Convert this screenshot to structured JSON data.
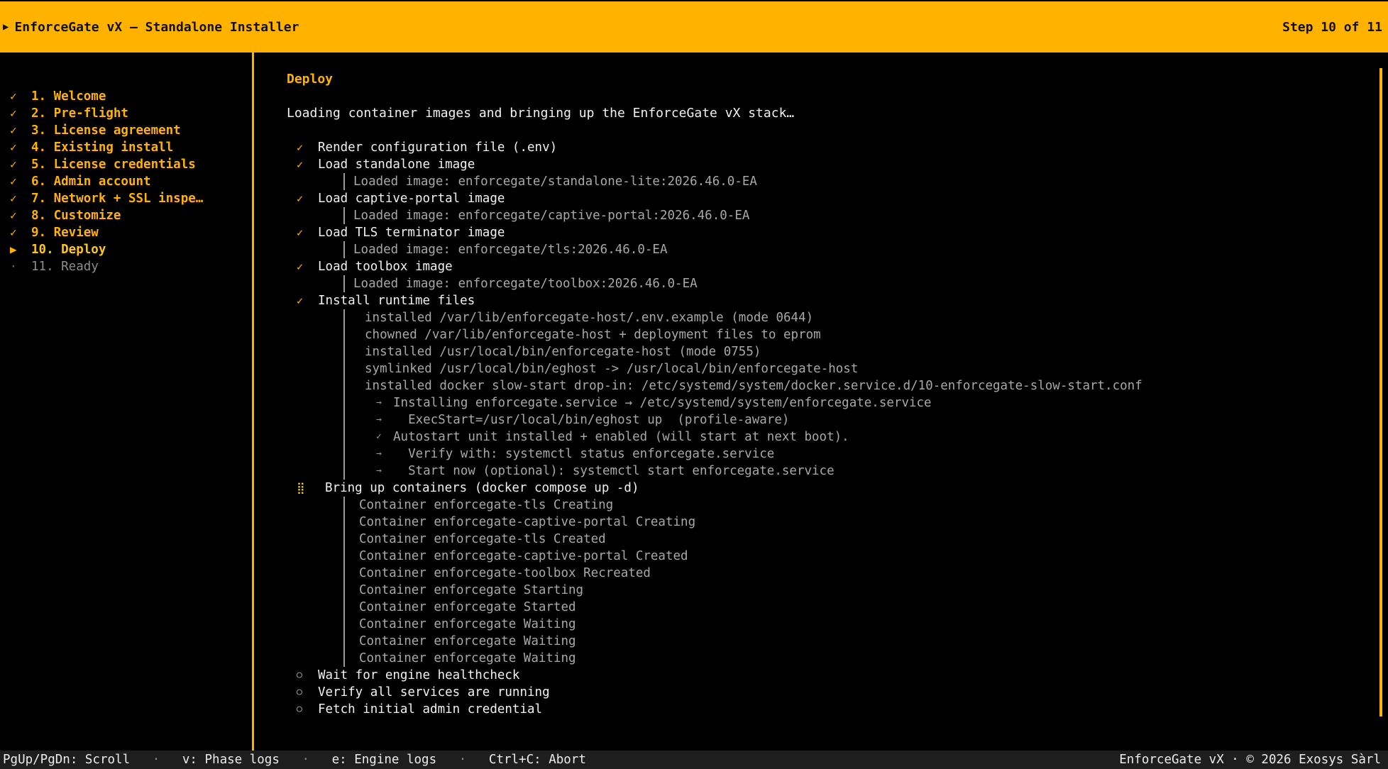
{
  "app": {
    "title_glyph": "▶",
    "title": "EnforceGate vX — Standalone Installer",
    "step_indicator": "Step 10 of 11"
  },
  "sidebar": {
    "items": [
      {
        "mark": "✓",
        "label": "1. Welcome",
        "state": "done"
      },
      {
        "mark": "✓",
        "label": "2. Pre-flight",
        "state": "done"
      },
      {
        "mark": "✓",
        "label": "3. License agreement",
        "state": "done"
      },
      {
        "mark": "✓",
        "label": "4. Existing install",
        "state": "done"
      },
      {
        "mark": "✓",
        "label": "5. License credentials",
        "state": "done"
      },
      {
        "mark": "✓",
        "label": "6. Admin account",
        "state": "done"
      },
      {
        "mark": "✓",
        "label": "7. Network + SSL inspe…",
        "state": "done"
      },
      {
        "mark": "✓",
        "label": "8. Customize",
        "state": "done"
      },
      {
        "mark": "✓",
        "label": "9. Review",
        "state": "done"
      },
      {
        "mark": "▶",
        "label": "10. Deploy",
        "state": "current"
      },
      {
        "mark": "·",
        "label": "11. Ready",
        "state": "pending"
      }
    ]
  },
  "main": {
    "heading": "Deploy",
    "intro": "Loading container images and bringing up the EnforceGate vX stack…",
    "lines": [
      {
        "kind": "step",
        "icon": "✓",
        "status": "done",
        "text": "Render configuration file (.env)"
      },
      {
        "kind": "step",
        "icon": "✓",
        "status": "done",
        "text": "Load standalone image"
      },
      {
        "kind": "log",
        "indent": 1,
        "text": "Loaded image: enforcegate/standalone-lite:2026.46.0-EA"
      },
      {
        "kind": "step",
        "icon": "✓",
        "status": "done",
        "text": "Load captive-portal image"
      },
      {
        "kind": "log",
        "indent": 1,
        "text": "Loaded image: enforcegate/captive-portal:2026.46.0-EA"
      },
      {
        "kind": "step",
        "icon": "✓",
        "status": "done",
        "text": "Load TLS terminator image"
      },
      {
        "kind": "log",
        "indent": 1,
        "text": "Loaded image: enforcegate/tls:2026.46.0-EA"
      },
      {
        "kind": "step",
        "icon": "✓",
        "status": "done",
        "text": "Load toolbox image"
      },
      {
        "kind": "log",
        "indent": 1,
        "text": "Loaded image: enforcegate/toolbox:2026.46.0-EA"
      },
      {
        "kind": "step",
        "icon": "✓",
        "status": "done",
        "text": "Install runtime files"
      },
      {
        "kind": "log",
        "indent": 2,
        "text": "installed /var/lib/enforcegate-host/.env.example (mode 0644)"
      },
      {
        "kind": "log",
        "indent": 2,
        "text": "chowned /var/lib/enforcegate-host + deployment files to eprom"
      },
      {
        "kind": "log",
        "indent": 2,
        "text": "installed /usr/local/bin/enforcegate-host (mode 0755)"
      },
      {
        "kind": "log",
        "indent": 2,
        "text": "symlinked /usr/local/bin/eghost -> /usr/local/bin/enforcegate-host"
      },
      {
        "kind": "log",
        "indent": 2,
        "text": "installed docker slow-start drop-in: /etc/systemd/system/docker.service.d/10-enforcegate-slow-start.conf"
      },
      {
        "kind": "log",
        "indent": 3,
        "prefix": "→",
        "text": "Installing enforcegate.service → /etc/systemd/system/enforcegate.service"
      },
      {
        "kind": "log",
        "indent": 3,
        "prefix": "→",
        "text": "  ExecStart=/usr/local/bin/eghost up  (profile-aware)"
      },
      {
        "kind": "log",
        "indent": 3,
        "prefix": "✓",
        "text": "Autostart unit installed + enabled (will start at next boot)."
      },
      {
        "kind": "log",
        "indent": 3,
        "prefix": "→",
        "text": "  Verify with: systemctl status enforcegate.service"
      },
      {
        "kind": "log",
        "indent": 3,
        "prefix": "→",
        "text": "  Start now (optional): systemctl start enforcegate.service"
      },
      {
        "kind": "step",
        "icon": "⣿",
        "status": "running",
        "text": "Bring up containers (docker compose up -d)"
      },
      {
        "kind": "log",
        "indent": 4,
        "text": "Container enforcegate-tls Creating"
      },
      {
        "kind": "log",
        "indent": 4,
        "text": "Container enforcegate-captive-portal Creating"
      },
      {
        "kind": "log",
        "indent": 4,
        "text": "Container enforcegate-tls Created"
      },
      {
        "kind": "log",
        "indent": 4,
        "text": "Container enforcegate-captive-portal Created"
      },
      {
        "kind": "log",
        "indent": 4,
        "text": "Container enforcegate-toolbox Recreated"
      },
      {
        "kind": "log",
        "indent": 4,
        "text": "Container enforcegate Starting"
      },
      {
        "kind": "log",
        "indent": 4,
        "text": "Container enforcegate Started"
      },
      {
        "kind": "log",
        "indent": 4,
        "text": "Container enforcegate Waiting"
      },
      {
        "kind": "log",
        "indent": 4,
        "text": "Container enforcegate Waiting"
      },
      {
        "kind": "log",
        "indent": 4,
        "text": "Container enforcegate Waiting"
      },
      {
        "kind": "step",
        "icon": "○",
        "status": "pending",
        "text": "Wait for engine healthcheck"
      },
      {
        "kind": "step",
        "icon": "○",
        "status": "pending",
        "text": "Verify all services are running"
      },
      {
        "kind": "step",
        "icon": "○",
        "status": "pending",
        "text": "Fetch initial admin credential"
      }
    ]
  },
  "status_bar": {
    "hints": [
      "PgUp/PgDn: Scroll",
      "v: Phase logs",
      "e: Engine logs",
      "Ctrl+C: Abort"
    ],
    "separator": "·",
    "right": "EnforceGate vX · © 2026 Exosys Sàrl"
  },
  "colors": {
    "accent": "#ffb300",
    "background": "#000000",
    "text": "#f2f2f2",
    "log_text": "#a8a8a8",
    "status_bar_bg": "#1e1e1e"
  }
}
